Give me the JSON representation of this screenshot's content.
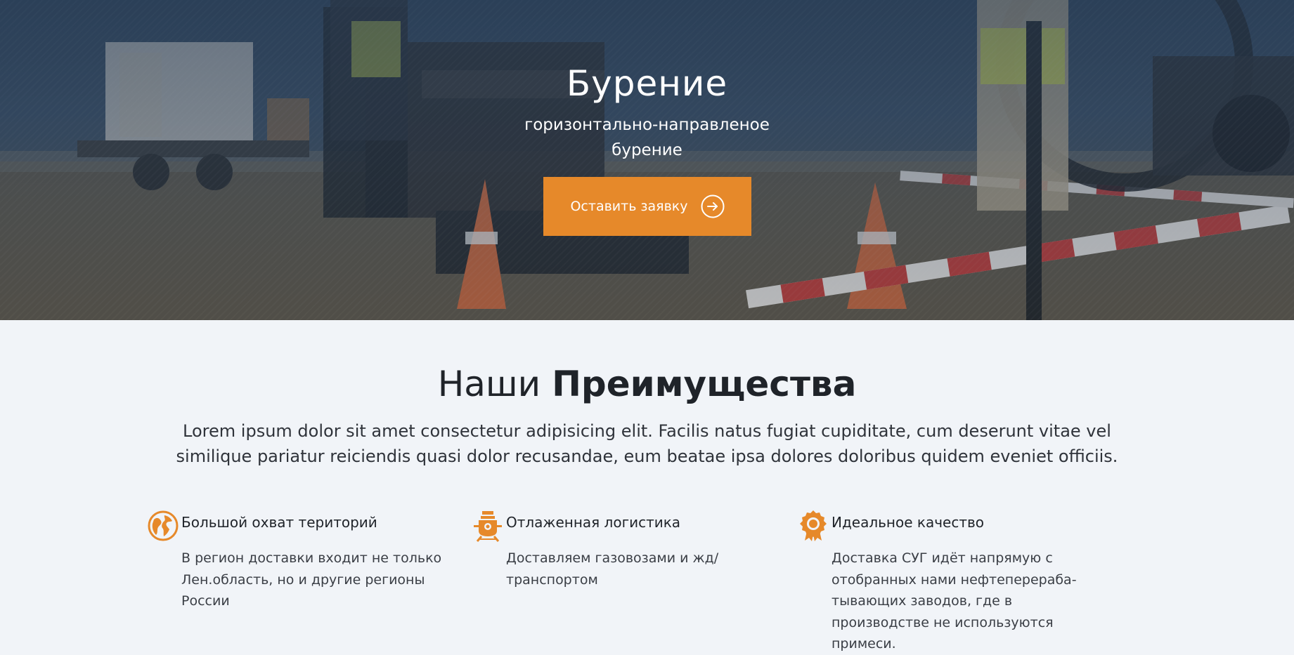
{
  "hero": {
    "title": "Бурение",
    "subtitle": "горизонтально-направленое бурение",
    "cta_label": "Оставить заявку",
    "cta_icon": "arrow-right-circle-icon"
  },
  "advantages": {
    "title_light": "Наши",
    "title_bold": "Преимущества",
    "lead": "Lorem ipsum dolor sit amet consectetur adipisicing elit. Facilis natus fugiat cupiditate, cum deserunt vitae vel similique pariatur reiciendis quasi dolor recusandae, eum beatae ipsa dolores doloribus quidem eveniet officiis.",
    "items": [
      {
        "icon": "globe-icon",
        "title": "Большой охват територий",
        "text": "В регион доставки входит не только Лен.область, но и другие регионы России"
      },
      {
        "icon": "train-icon",
        "title": "Отлаженная логистика",
        "text": "Доставляем газовозами и жд/транспортом"
      },
      {
        "icon": "award-medal-icon",
        "title": "Идеальное качество",
        "text": "Доставка СУГ идёт напрямую с отобранных нами нефтеперераба-тывающих заводов, где в производстве не используются примеси."
      }
    ]
  },
  "colors": {
    "accent": "#e6892a",
    "section_bg": "#f1f4f8",
    "hero_overlay": "#2f4258",
    "heading": "#1f2329"
  }
}
